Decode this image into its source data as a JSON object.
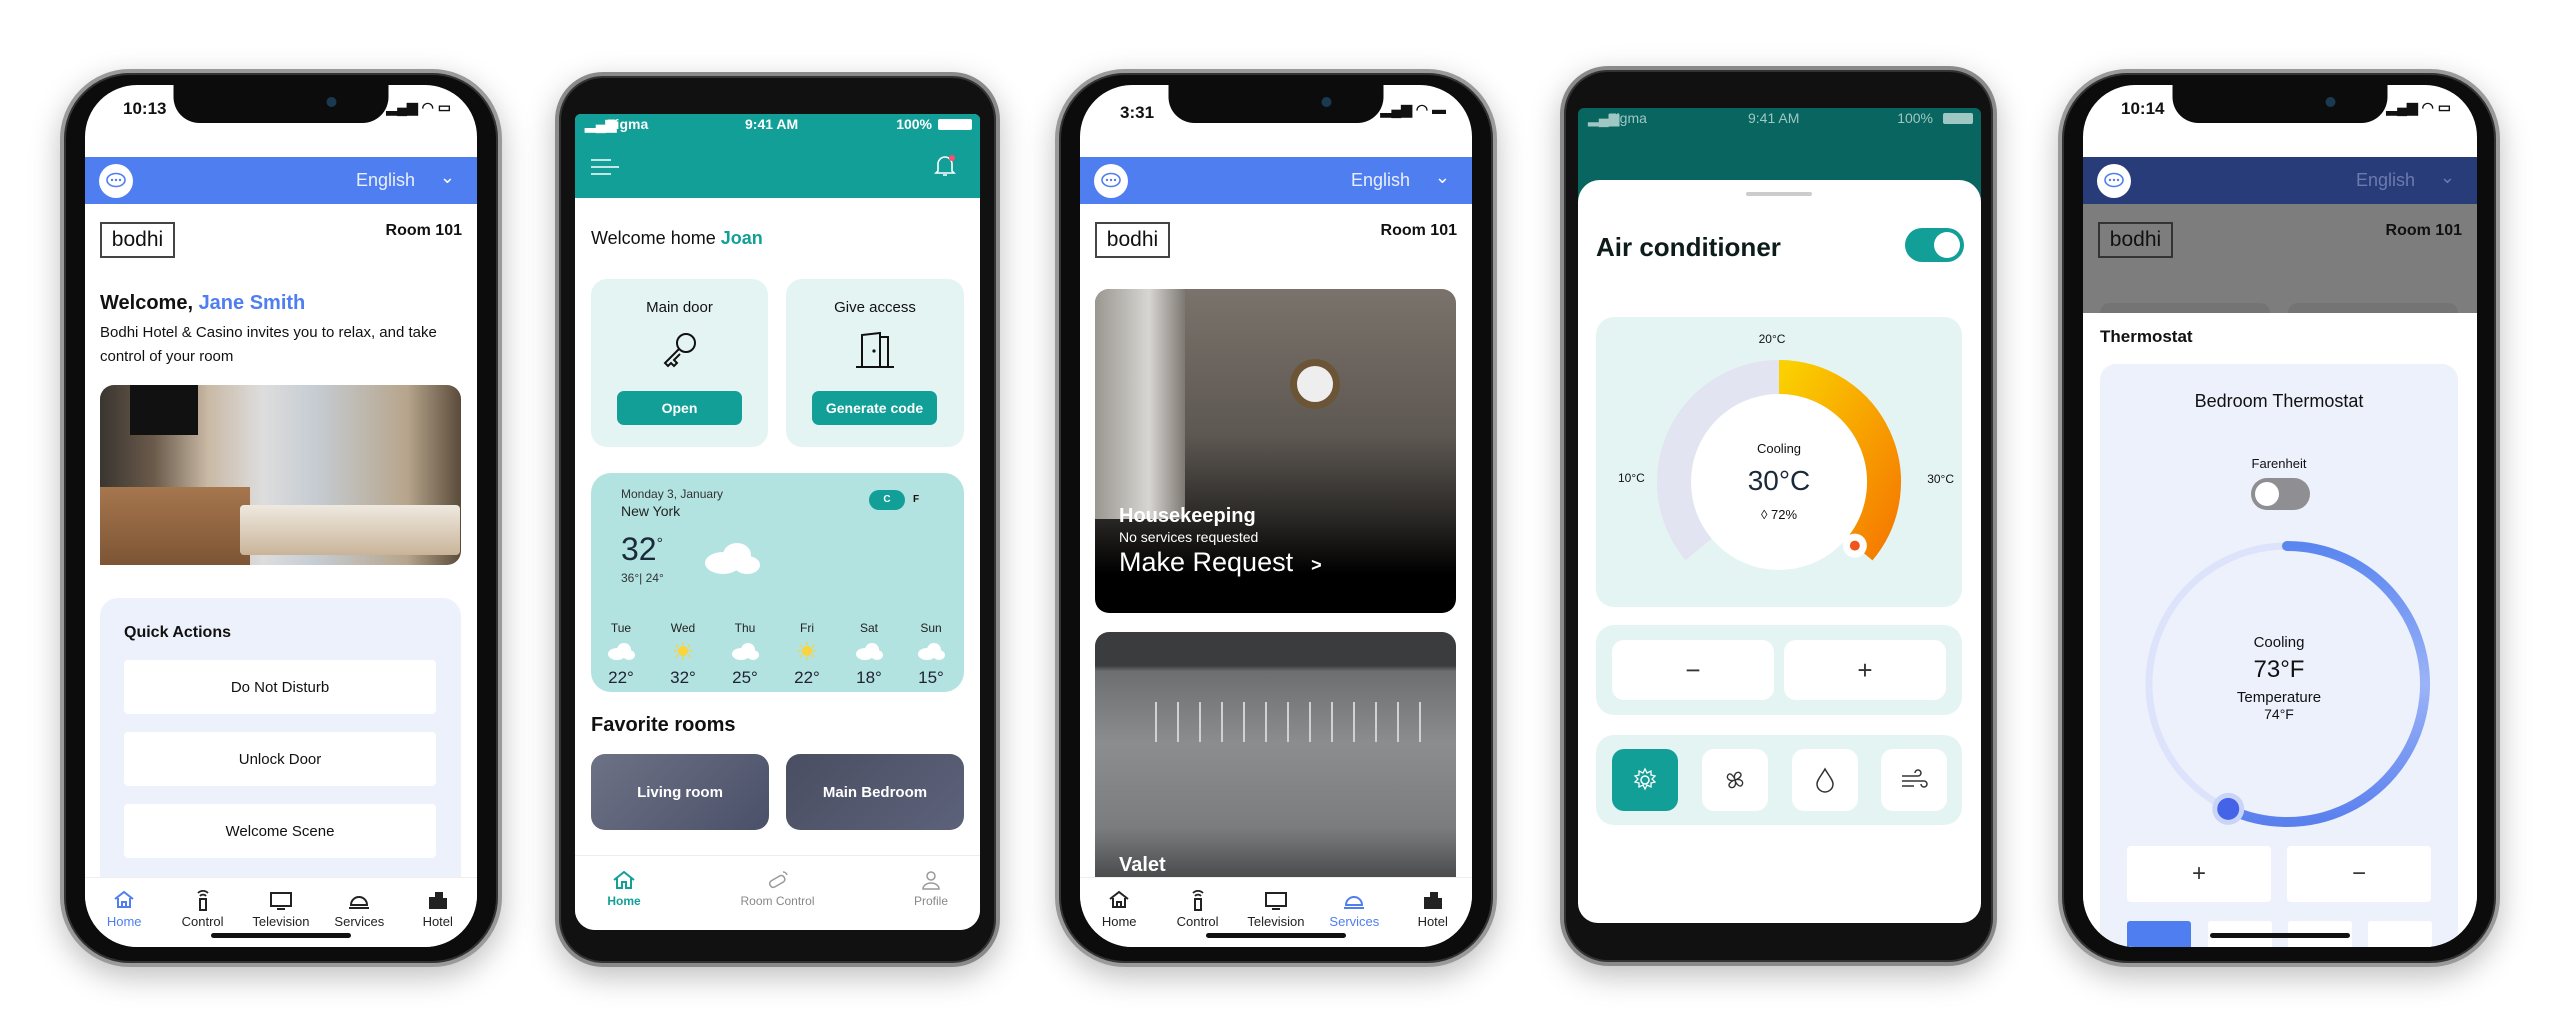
{
  "phone1": {
    "status_time": "10:13",
    "language": "English",
    "brand": "bodhi",
    "room": "Room 101",
    "welcome_prefix": "Welcome, ",
    "guest_name": "Jane Smith",
    "subtitle": "Bodhi Hotel & Casino invites you to relax, and take control of your room",
    "quick_actions_title": "Quick Actions",
    "quick_actions": [
      "Do Not Disturb",
      "Unlock Door",
      "Welcome Scene"
    ],
    "tabs": [
      {
        "label": "Home",
        "icon": "home-icon",
        "active": true
      },
      {
        "label": "Control",
        "icon": "remote-icon"
      },
      {
        "label": "Television",
        "icon": "tv-icon"
      },
      {
        "label": "Services",
        "icon": "service-bell-icon"
      },
      {
        "label": "Hotel",
        "icon": "building-icon"
      }
    ]
  },
  "phone2": {
    "carrier": "Figma",
    "status_time": "9:41 AM",
    "battery": "100%",
    "welcome_prefix": "Welcome home ",
    "user_name": "Joan",
    "main_door": {
      "title": "Main door",
      "button": "Open"
    },
    "give_access": {
      "title": "Give access",
      "button": "Generate code"
    },
    "weather": {
      "date": "Monday 3, January",
      "city": "New York",
      "temp": "32",
      "high_low": "36°| 24°",
      "unit_c": "C",
      "unit_f": "F",
      "forecast": [
        {
          "day": "Tue",
          "icon": "cloud",
          "temp": "22°"
        },
        {
          "day": "Wed",
          "icon": "sun",
          "temp": "32°"
        },
        {
          "day": "Thu",
          "icon": "cloud",
          "temp": "25°"
        },
        {
          "day": "Fri",
          "icon": "sun",
          "temp": "22°"
        },
        {
          "day": "Sat",
          "icon": "cloud",
          "temp": "18°"
        },
        {
          "day": "Sun",
          "icon": "cloud",
          "temp": "15°"
        }
      ]
    },
    "favorites_title": "Favorite rooms",
    "favorites": [
      "Living room",
      "Main Bedroom"
    ],
    "tabs": [
      {
        "label": "Home",
        "active": true
      },
      {
        "label": "Room Control"
      },
      {
        "label": "Profile"
      }
    ]
  },
  "phone3": {
    "status_time": "3:31",
    "language": "English",
    "brand": "bodhi",
    "room": "Room 101",
    "housekeeping": {
      "title": "Housekeeping",
      "status": "No services requested",
      "action": "Make Request",
      "chevron": ">"
    },
    "valet": {
      "title": "Valet"
    },
    "tabs": [
      {
        "label": "Home"
      },
      {
        "label": "Control"
      },
      {
        "label": "Television"
      },
      {
        "label": "Services",
        "active": true
      },
      {
        "label": "Hotel"
      }
    ]
  },
  "phone4": {
    "carrier": "Figma",
    "status_time": "9:41 AM",
    "battery": "100%",
    "title": "Air conditioner",
    "power_on": true,
    "gauge": {
      "min_label": "10°C",
      "mid_label": "20°C",
      "max_label": "30°C",
      "mode": "Cooling",
      "value_label": "30°C",
      "humidity": "72%",
      "min": 10,
      "max": 30,
      "value": 30
    },
    "minus": "−",
    "plus": "+",
    "modes": [
      {
        "icon": "gear-icon",
        "active": true
      },
      {
        "icon": "fan-icon"
      },
      {
        "icon": "drop-icon"
      },
      {
        "icon": "wind-icon"
      }
    ]
  },
  "phone5": {
    "status_time": "10:14",
    "language": "English",
    "brand": "bodhi",
    "room": "Room 101",
    "section_title": "Thermostat",
    "card_title": "Bedroom Thermostat",
    "unit_toggle_label": "Farenheit",
    "fahrenheit_on": false,
    "mode": "Cooling",
    "setpoint": "73°F",
    "temperature_label": "Temperature",
    "temperature": "74°F",
    "dial_fraction": 0.57,
    "plus": "+",
    "minus": "−"
  },
  "colors": {
    "blue": "#4f7ef0",
    "teal": "#119f98",
    "teal_light": "#e4f4f3",
    "orange": "#f57c00",
    "yellow": "#fbc400",
    "lavender": "#edf1fc"
  }
}
